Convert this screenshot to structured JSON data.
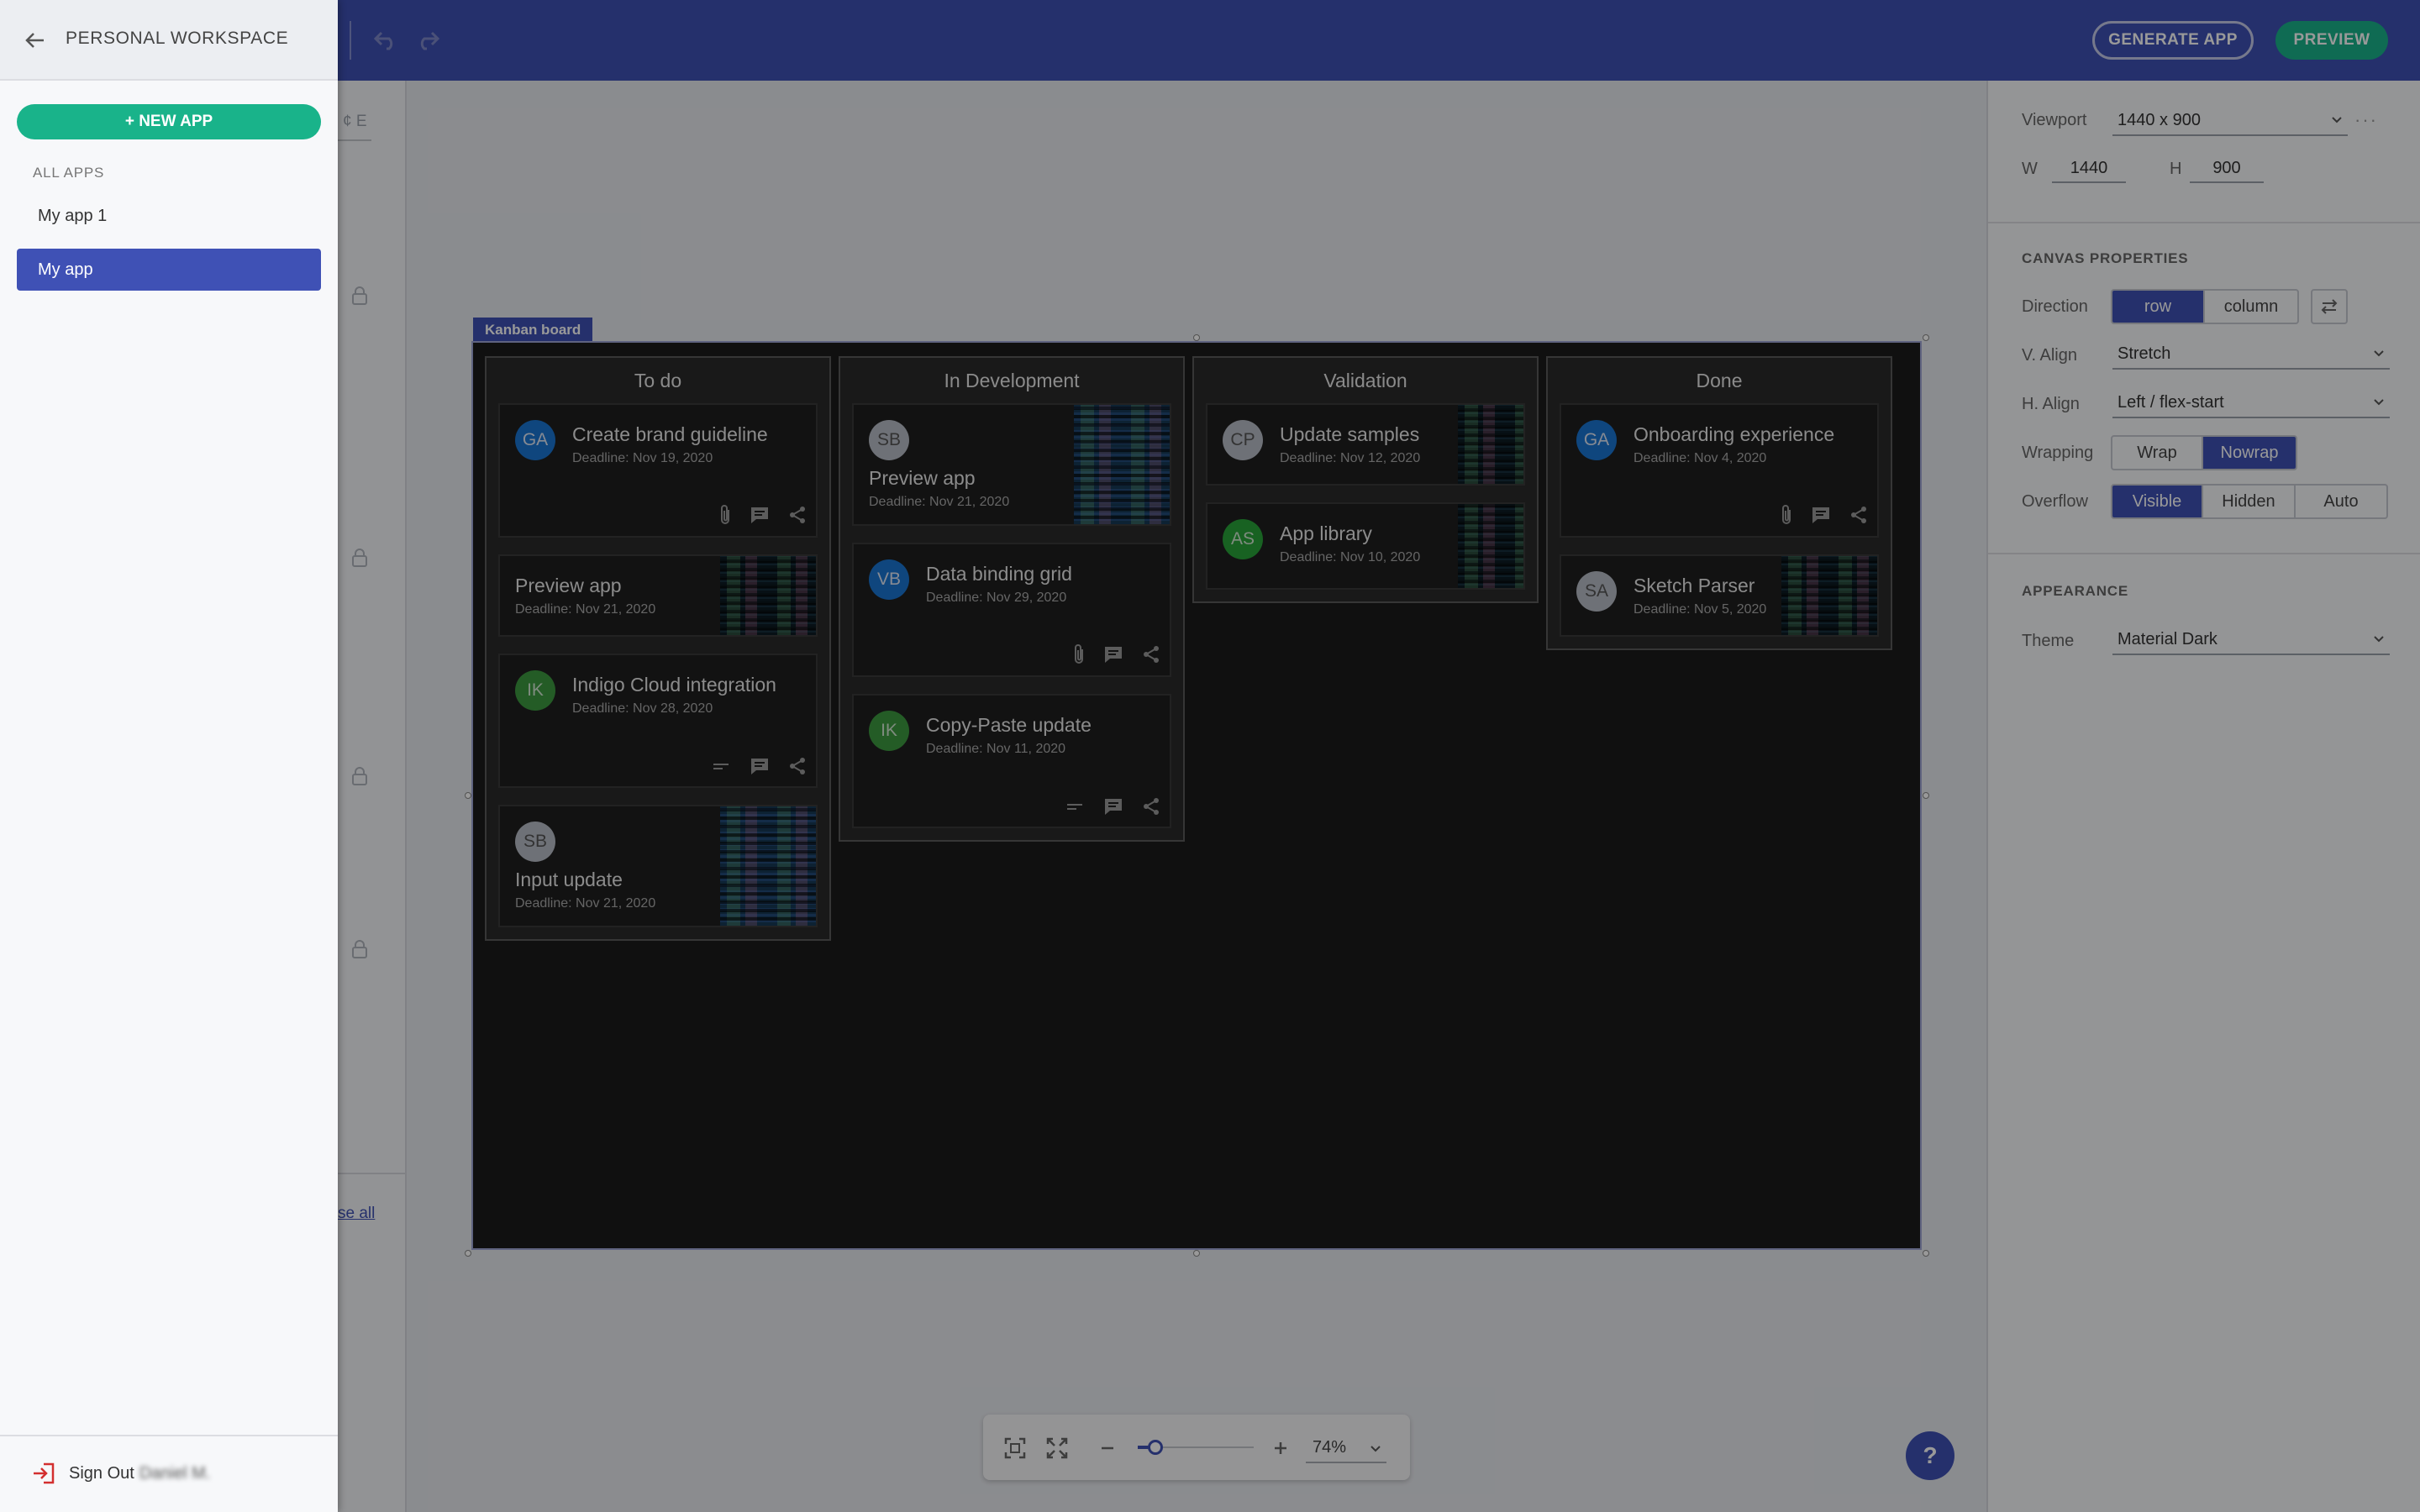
{
  "drawer": {
    "title": "PERSONAL WORKSPACE",
    "new_app_label": "+ NEW APP",
    "section_label": "ALL APPS",
    "apps": [
      {
        "label": "My app 1",
        "active": false
      },
      {
        "label": "My app",
        "active": true
      }
    ],
    "sign_out_label": "Sign Out",
    "user_name": "Daniel M."
  },
  "toolbar": {
    "generate_label": "GENERATE APP",
    "preview_label": "PREVIEW"
  },
  "left_strip": {
    "hint_text": "¢ E",
    "close_all_label": "se all"
  },
  "right_panel": {
    "viewport_label": "Viewport",
    "viewport_value": "1440 x 900",
    "w_label": "W",
    "w_value": "1440",
    "h_label": "H",
    "h_value": "900",
    "canvas_section": "CANVAS PROPERTIES",
    "direction_label": "Direction",
    "direction_options": [
      "row",
      "column"
    ],
    "direction_selected": "row",
    "valign_label": "V. Align",
    "valign_value": "Stretch",
    "halign_label": "H. Align",
    "halign_value": "Left / flex-start",
    "wrapping_label": "Wrapping",
    "wrapping_options": [
      "Wrap",
      "Nowrap"
    ],
    "wrapping_selected": "Nowrap",
    "overflow_label": "Overflow",
    "overflow_options": [
      "Visible",
      "Hidden",
      "Auto"
    ],
    "overflow_selected": "Visible",
    "appearance_section": "APPEARANCE",
    "theme_label": "Theme",
    "theme_value": "Material Dark"
  },
  "kanban": {
    "tag": "Kanban board",
    "columns": [
      {
        "title": "To do",
        "cards": [
          {
            "initials": "GA",
            "title": "Create brand guideline",
            "deadline": "Deadline: Nov 19, 2020"
          },
          {
            "title": "Preview app",
            "deadline": "Deadline: Nov 21, 2020"
          },
          {
            "initials": "IK",
            "title": "Indigo Cloud integration",
            "deadline": "Deadline: Nov 28, 2020"
          },
          {
            "initials": "SB",
            "title": "Input update",
            "deadline": "Deadline: Nov 21, 2020"
          }
        ]
      },
      {
        "title": "In Development",
        "cards": [
          {
            "initials": "SB",
            "title": "Preview app",
            "deadline": "Deadline: Nov 21, 2020"
          },
          {
            "initials": "VB",
            "title": "Data binding grid",
            "deadline": "Deadline: Nov 29, 2020"
          },
          {
            "initials": "IK",
            "title": "Copy-Paste update",
            "deadline": "Deadline: Nov 11, 2020"
          }
        ]
      },
      {
        "title": "Validation",
        "cards": [
          {
            "initials": "CP",
            "title": "Update samples",
            "deadline": "Deadline: Nov 12, 2020"
          },
          {
            "initials": "AS",
            "title": "App library",
            "deadline": "Deadline: Nov 10, 2020"
          }
        ]
      },
      {
        "title": "Done",
        "cards": [
          {
            "initials": "GA",
            "title": "Onboarding experience",
            "deadline": "Deadline: Nov 4, 2020"
          },
          {
            "initials": "SA",
            "title": "Sketch Parser",
            "deadline": "Deadline: Nov 5, 2020"
          }
        ]
      }
    ]
  },
  "zoom": {
    "value": "74%",
    "slider_fraction": 0.15
  },
  "help_label": "?",
  "colors": {
    "primary": "#3f51b5",
    "accent": "#19b38a",
    "board_bg": "#1c1c1c"
  }
}
